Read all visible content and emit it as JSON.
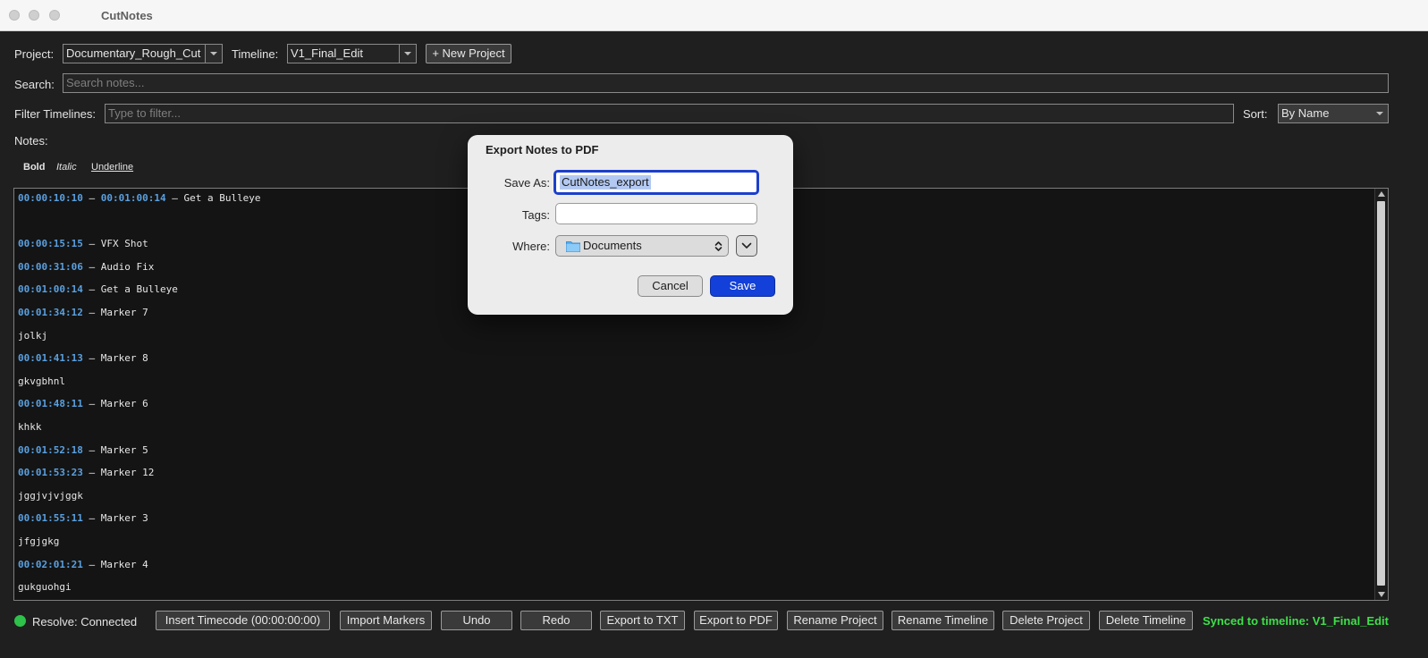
{
  "app": {
    "title": "CutNotes"
  },
  "project": {
    "label": "Project:",
    "value": "Documentary_Rough_Cut"
  },
  "timeline": {
    "label": "Timeline:",
    "value": "V1_Final_Edit"
  },
  "new_project_button": "+ New Project",
  "search": {
    "label": "Search:",
    "placeholder": "Search notes..."
  },
  "filter": {
    "label": "Filter Timelines:",
    "placeholder": "Type to filter..."
  },
  "sort": {
    "label": "Sort:",
    "value": "By Name"
  },
  "notes_label": "Notes:",
  "format": {
    "bold": "Bold",
    "italic": "Italic",
    "underline": "Underline"
  },
  "notes": [
    {
      "timecode": "00:00:10:10",
      "timecode_end": "00:01:00:14",
      "text": " – Get a Bulleye"
    },
    {
      "timecode": "",
      "timecode_end": "",
      "text": ""
    },
    {
      "timecode": "00:00:15:15",
      "timecode_end": "",
      "text": " – VFX Shot"
    },
    {
      "timecode": "00:00:31:06",
      "timecode_end": "",
      "text": " – Audio Fix"
    },
    {
      "timecode": "00:01:00:14",
      "timecode_end": "",
      "text": " – Get a Bulleye"
    },
    {
      "timecode": "00:01:34:12",
      "timecode_end": "",
      "text": " – Marker 7"
    },
    {
      "timecode": "",
      "timecode_end": "",
      "text": "jolkj"
    },
    {
      "timecode": "00:01:41:13",
      "timecode_end": "",
      "text": " – Marker 8"
    },
    {
      "timecode": "",
      "timecode_end": "",
      "text": "gkvgbhnl"
    },
    {
      "timecode": "00:01:48:11",
      "timecode_end": "",
      "text": " – Marker 6"
    },
    {
      "timecode": "",
      "timecode_end": "",
      "text": "khkk"
    },
    {
      "timecode": "00:01:52:18",
      "timecode_end": "",
      "text": " – Marker 5"
    },
    {
      "timecode": "00:01:53:23",
      "timecode_end": "",
      "text": " – Marker 12"
    },
    {
      "timecode": "",
      "timecode_end": "",
      "text": "jggjvjvjggk"
    },
    {
      "timecode": "00:01:55:11",
      "timecode_end": "",
      "text": " – Marker 3"
    },
    {
      "timecode": "",
      "timecode_end": "",
      "text": "jfgjgkg"
    },
    {
      "timecode": "00:02:01:21",
      "timecode_end": "",
      "text": " – Marker 4"
    },
    {
      "timecode": "",
      "timecode_end": "",
      "text": "gukguohgi"
    }
  ],
  "status": {
    "connection": "Resolve: Connected",
    "synced": "Synced to timeline: V1_Final_Edit"
  },
  "toolbar": {
    "insert_timecode": "Insert Timecode (00:00:00:00)",
    "import_markers": "Import Markers",
    "undo": "Undo",
    "redo": "Redo",
    "export_txt": "Export to TXT",
    "export_pdf": "Export to PDF",
    "rename_project": "Rename Project",
    "rename_timeline": "Rename Timeline",
    "delete_project": "Delete Project",
    "delete_timeline": "Delete Timeline"
  },
  "dialog": {
    "title": "Export Notes to PDF",
    "save_as_label": "Save As:",
    "save_as_value": "CutNotes_export",
    "tags_label": "Tags:",
    "tags_value": "",
    "where_label": "Where:",
    "where_value": "Documents",
    "cancel": "Cancel",
    "save": "Save"
  },
  "icons": {
    "dropdown": "chevron-down-icon",
    "folder": "folder-icon",
    "updown": "up-down-chevron-icon",
    "expand": "chevron-down-icon",
    "status": "status-dot-icon"
  },
  "colors": {
    "timecode": "#5aa0e0",
    "status_connected": "#2ec24a",
    "synced_text": "#3ee04a",
    "save_button": "#1340d8",
    "focus_ring": "#1d3fcb"
  }
}
